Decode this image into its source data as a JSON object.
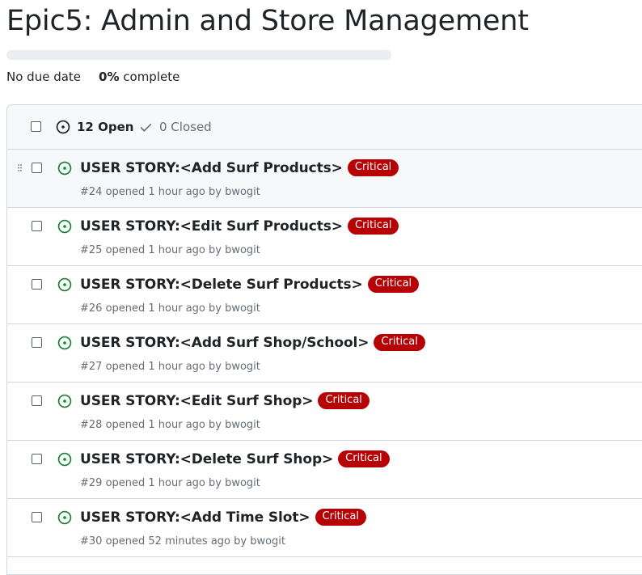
{
  "milestone": {
    "title": "Epic5: Admin and Store Management",
    "due": "No due date",
    "percent": "0%",
    "percent_suffix": "complete",
    "progress_fraction": 0
  },
  "list_header": {
    "open_label": "12 Open",
    "closed_label": "0 Closed"
  },
  "issues": [
    {
      "title": "USER STORY:<Add Surf Products>",
      "label": "Critical",
      "meta": "#24 opened 1 hour ago by bwogit"
    },
    {
      "title": "USER STORY:<Edit Surf Products>",
      "label": "Critical",
      "meta": "#25 opened 1 hour ago by bwogit"
    },
    {
      "title": "USER STORY:<Delete Surf Products>",
      "label": "Critical",
      "meta": "#26 opened 1 hour ago by bwogit"
    },
    {
      "title": "USER STORY:<Add Surf Shop/School>",
      "label": "Critical",
      "meta": "#27 opened 1 hour ago by bwogit"
    },
    {
      "title": "USER STORY:<Edit Surf Shop>",
      "label": "Critical",
      "meta": "#28 opened 1 hour ago by bwogit"
    },
    {
      "title": "USER STORY:<Delete Surf Shop>",
      "label": "Critical",
      "meta": "#29 opened 1 hour ago by bwogit"
    },
    {
      "title": "USER STORY:<Add Time Slot>",
      "label": "Critical",
      "meta": "#30 opened 52 minutes ago by bwogit"
    }
  ],
  "colors": {
    "open_green": "#1a7f37",
    "label_red": "#b60205",
    "muted": "#656d76"
  }
}
